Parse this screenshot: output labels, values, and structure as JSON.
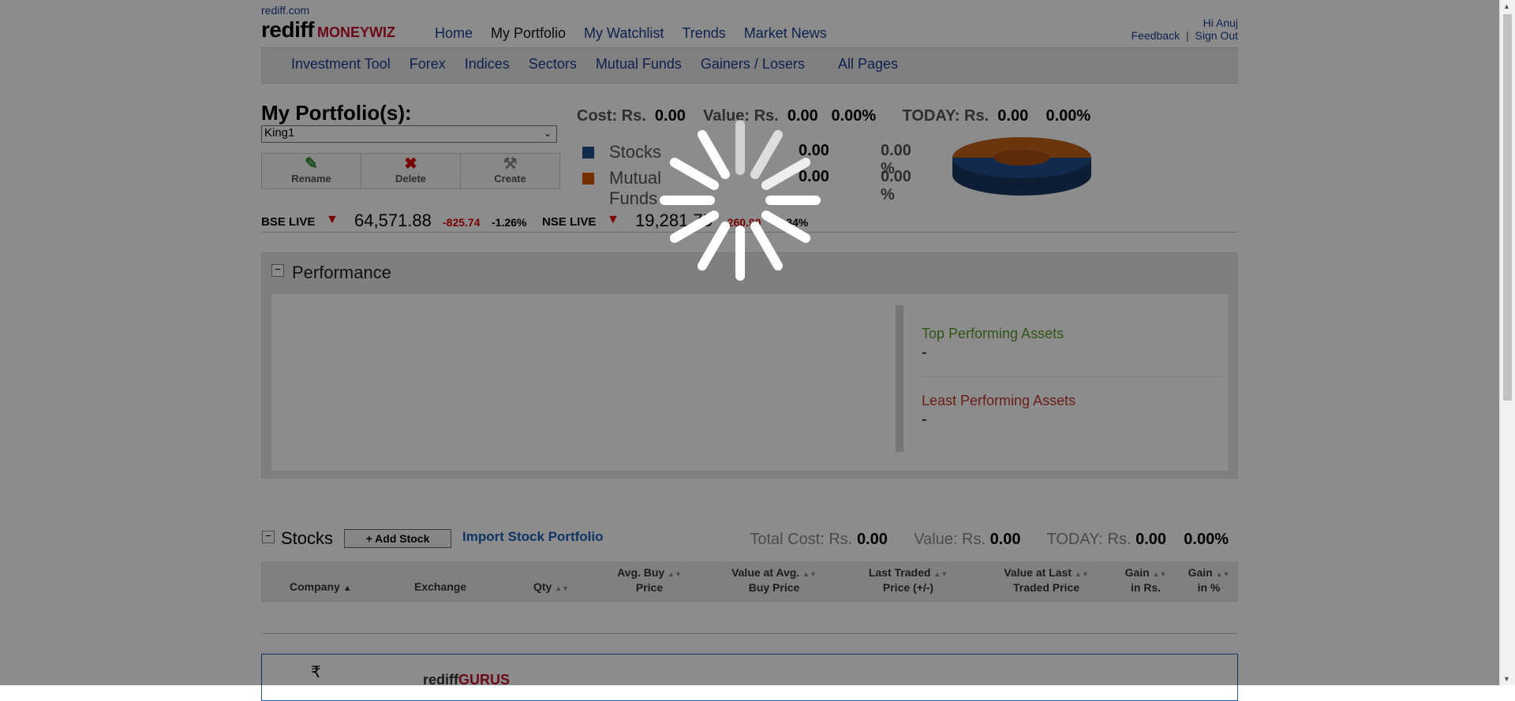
{
  "header": {
    "site_link": "rediff.com",
    "logo_main": "rediff",
    "logo_sub": "MONEYWIZ",
    "nav": [
      "Home",
      "My Portfolio",
      "My Watchlist",
      "Trends",
      "Market News"
    ],
    "greeting": "Hi Anuj",
    "feedback": "Feedback",
    "divider": "|",
    "signout": "Sign Out"
  },
  "subnav": [
    "Investment Tool",
    "Forex",
    "Indices",
    "Sectors",
    "Mutual Funds",
    "Gainers / Losers",
    "All Pages"
  ],
  "portfolio": {
    "title": "My Portfolio(s):",
    "selected": "King1",
    "actions": [
      "Rename",
      "Delete",
      "Create"
    ]
  },
  "summary": {
    "cost_label": "Cost: Rs.",
    "cost": "0.00",
    "value_label": "Value: Rs.",
    "value": "0.00",
    "value_pct": "0.00%",
    "today_label": "TODAY: Rs.",
    "today": "0.00",
    "today_pct": "0.00%",
    "legend": [
      {
        "name": "Stocks",
        "value": "0.00",
        "pct": "0.00 %",
        "color": "#1f4e8c"
      },
      {
        "name": "Mutual Funds",
        "value": "0.00",
        "pct": "0.00 %",
        "color": "#d35400"
      }
    ]
  },
  "ticker": {
    "bse": {
      "label": "BSE LIVE",
      "level": "64,571.88",
      "change": "-825.74",
      "pct": "-1.26%"
    },
    "nse": {
      "label": "NSE LIVE",
      "level": "19,281.75",
      "change": "-260.90",
      "pct": "-1.34%"
    }
  },
  "performance": {
    "title": "Performance",
    "top_label": "Top Performing Assets",
    "top_value": "-",
    "least_label": "Least Performing Assets",
    "least_value": "-"
  },
  "stocks": {
    "title": "Stocks",
    "add_button": "+ Add Stock",
    "import_link": "Import Stock Portfolio",
    "total_cost_label": "Total Cost: Rs.",
    "total_cost": "0.00",
    "value_label": "Value: Rs.",
    "value": "0.00",
    "today_label": "TODAY: Rs.",
    "today": "0.00",
    "today_pct": "0.00%",
    "columns": {
      "company": "Company",
      "exchange": "Exchange",
      "qty": "Qty",
      "avg_buy_1": "Avg. Buy",
      "avg_buy_2": "Price",
      "val_avg_1": "Value at Avg.",
      "val_avg_2": "Buy Price",
      "ltp_1": "Last Traded",
      "ltp_2": "Price (+/-)",
      "val_ltp_1": "Value at Last",
      "val_ltp_2": "Traded Price",
      "gain_rs_1": "Gain",
      "gain_rs_2": "in Rs.",
      "gain_pct_1": "Gain",
      "gain_pct_2": "in %"
    }
  },
  "gurus": {
    "prefix": "rediff",
    "suffix": "GURUS"
  },
  "icons": {
    "edit": "pencil-icon",
    "delete": "x-icon",
    "create": "tools-icon",
    "down": "double-down-arrow-icon",
    "rupee": "rupee-icon"
  },
  "colors": {
    "link": "#1a3d8f",
    "negative": "#dd0000",
    "stocks": "#1f4e8c",
    "mutual_funds": "#d35400",
    "top": "#5a9b2b",
    "least": "#c0392b"
  }
}
